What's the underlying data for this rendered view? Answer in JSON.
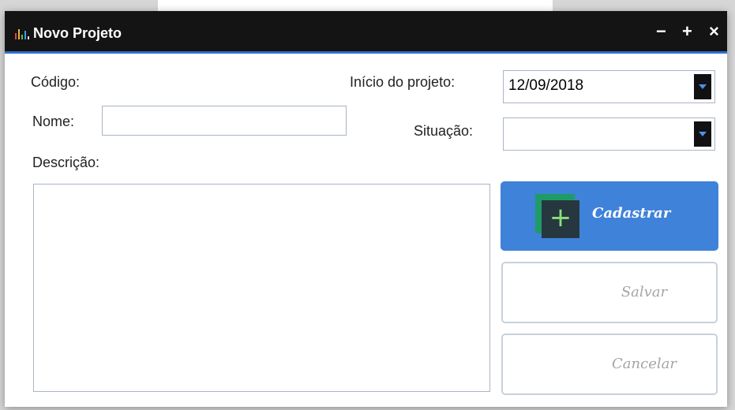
{
  "window": {
    "title": "Novo Projeto",
    "controls": {
      "minimize": "−",
      "maximize": "+",
      "close": "×"
    }
  },
  "form": {
    "codigo_label": "Código:",
    "nome_label": "Nome:",
    "nome_value": "",
    "descricao_label": "Descrição:",
    "descricao_value": "",
    "inicio_label": "Início do projeto:",
    "inicio_value": "12/09/2018",
    "situacao_label": "Situação:",
    "situacao_value": ""
  },
  "buttons": {
    "cadastrar": "Cadastrar",
    "salvar": "Salvar",
    "cancelar": "Cancelar"
  },
  "colors": {
    "titlebar": "#141414",
    "accent": "#3f82d9",
    "icon_green": "#1f9b67"
  },
  "icons": {
    "app": "bar-chart-icon",
    "add": "plus-icon",
    "dropdown": "caret-down-icon"
  }
}
